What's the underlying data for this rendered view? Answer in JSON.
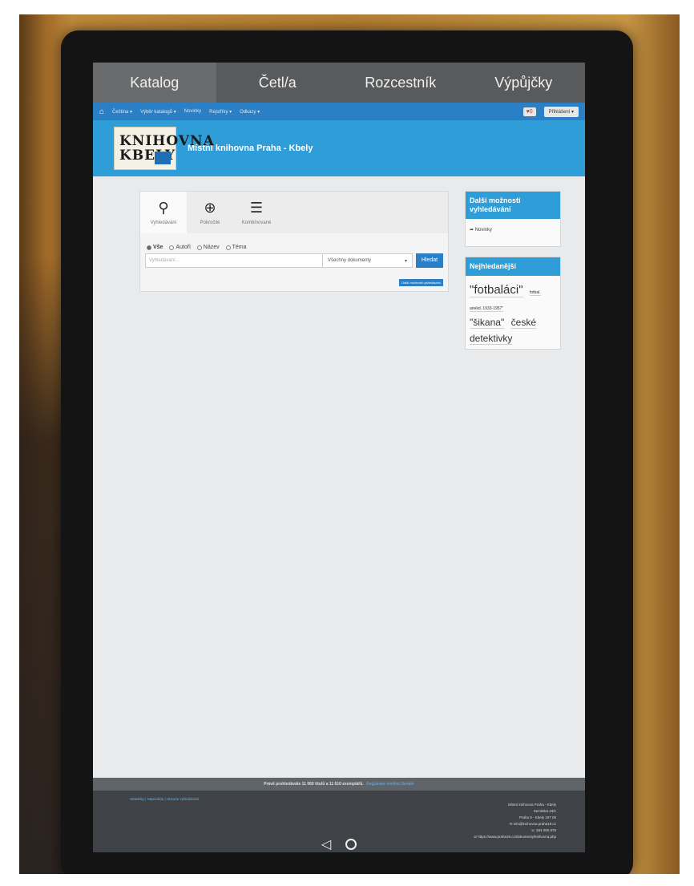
{
  "kiosk_tabs": [
    "Katalog",
    "Četl/a",
    "Rozcestník",
    "Výpůjčky"
  ],
  "navbar": {
    "items": [
      "Čeština ▾",
      "Výběr katalogů ▾",
      "Novinky",
      "Rejstříky ▾",
      "Odkazy ▾"
    ],
    "badge": "♥0",
    "login": "Přihlášení ▾"
  },
  "header": {
    "logo_line1": "KNIHOVNA",
    "logo_line2": "KBELY",
    "title": "Místní knihovna Praha - Kbely"
  },
  "search": {
    "tabs": [
      {
        "label": "Vyhledávání",
        "icon": "search-icon"
      },
      {
        "label": "Pokročilé",
        "icon": "zoom-plus-icon"
      },
      {
        "label": "Kombinované",
        "icon": "stack-icon"
      }
    ],
    "radios": [
      "Vše",
      "Autoři",
      "Název",
      "Téma"
    ],
    "placeholder": "Vyhledávání...",
    "doc_type": "Všechny dokumenty",
    "button": "Hledat",
    "more": "Další možnosti vyhledávání"
  },
  "sidebar": {
    "box1_title": "Další možnosti vyhledávání",
    "box1_link": "➦ Novinky",
    "box2_title": "Nejhledanější",
    "tags": [
      {
        "text": "\"fotbaláci\"",
        "size": "big"
      },
      {
        "text": "fotbal.",
        "size": "small"
      },
      {
        "text": "anekd. 1933-1957\"",
        "size": "small"
      },
      {
        "text": "\"šikana\"",
        "size": "mid"
      },
      {
        "text": "české detektivky",
        "size": "mid"
      }
    ]
  },
  "footer": {
    "stats_text": "Právě prohledáváte 11 060 titulů a 11 610 exemplářů.",
    "stats_link": "Registrace nového čtenáře",
    "left_links": "Statistiky | Nápověda | Historie vyhledávání",
    "address": [
      "Místní knihovna Praha - Kbely",
      "Semilská 43/1",
      "Praha 9 - Kbely 197 00",
      "✉ info@knihovna.praha19.cz",
      "☏ 284 080 878",
      "⊘ https://www.praha19.cz/dokumenty/knihovna.php"
    ]
  }
}
